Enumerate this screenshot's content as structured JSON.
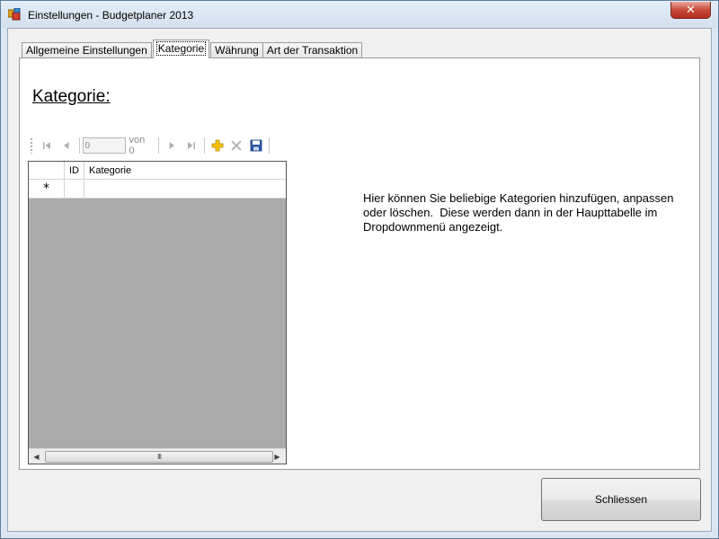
{
  "window": {
    "title": "Einstellungen - Budgetplaner 2013",
    "close_glyph": "✕"
  },
  "tabs": [
    {
      "label": "Allgemeine Einstellungen"
    },
    {
      "label": "Kategorie"
    },
    {
      "label": "Währung"
    },
    {
      "label": "Art der Transaktion"
    }
  ],
  "active_tab": "Kategorie",
  "page": {
    "title": "Kategorie:",
    "description": "Hier können Sie beliebige Kategorien hinzufügen, anpassen\noder löschen.  Diese werden dann in der Haupttabelle im\nDropdownmenü angezeigt."
  },
  "navigator": {
    "position_value": "0",
    "count_label": "von 0",
    "icons": [
      "move-first-icon",
      "move-previous-icon",
      "move-next-icon",
      "move-last-icon",
      "add-new-icon",
      "delete-icon",
      "save-icon"
    ]
  },
  "grid": {
    "columns": [
      "ID",
      "Kategorie"
    ],
    "new_row_marker": "*",
    "scroll_thumb_glyph": "III"
  },
  "buttons": {
    "close_label": "Schliessen"
  },
  "colors": {
    "grid_background": "#ababab",
    "add_icon": "#e8b400",
    "save_icon": "#2a56a8",
    "close_button_red": "#c7493a"
  }
}
